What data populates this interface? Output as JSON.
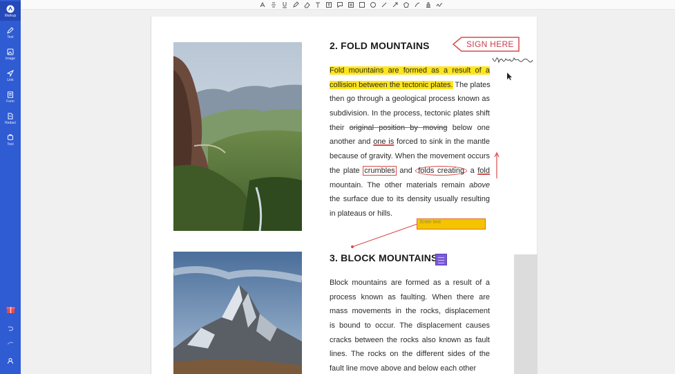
{
  "sidebar": {
    "items": [
      {
        "label": "Markup",
        "icon": "markup-icon"
      },
      {
        "label": "Text",
        "icon": "pencil-icon"
      },
      {
        "label": "Image",
        "icon": "image-icon"
      },
      {
        "label": "Link",
        "icon": "link-icon"
      },
      {
        "label": "Form",
        "icon": "form-icon"
      },
      {
        "label": "Redact",
        "icon": "redact-icon"
      },
      {
        "label": "Tool",
        "icon": "tool-icon"
      }
    ],
    "bottom_icons": [
      "gift-icon",
      "undo-icon",
      "redo-icon",
      "user-icon"
    ]
  },
  "toolbar": {
    "icons": [
      "highlight-icon",
      "strikethrough-icon",
      "underline-icon",
      "pencil-icon",
      "eraser-icon",
      "text-icon",
      "textbox-icon",
      "callout-icon",
      "note-icon",
      "rectangle-icon",
      "circle-icon",
      "line-icon",
      "arrow-icon",
      "polygon-icon",
      "pen-icon",
      "stamp-icon",
      "signature-icon"
    ]
  },
  "document": {
    "section1": {
      "heading": "2. FOLD MOUNTAINS",
      "lines": [
        {
          "parts": [
            {
              "t": "Fold mountains are formed as a result of a",
              "s": "hl"
            }
          ]
        },
        {
          "parts": [
            {
              "t": "collision between the tectonic plates.",
              "s": "hl"
            },
            {
              "t": " The plates"
            }
          ]
        },
        {
          "parts": [
            {
              "t": "then go through a geological process known as"
            }
          ]
        },
        {
          "parts": [
            {
              "t": "subdivision. In the process, tectonic plates shift"
            }
          ]
        },
        {
          "parts": [
            {
              "t": "their "
            },
            {
              "t": "original position by moving",
              "s": "strike"
            },
            {
              "t": " below one"
            }
          ]
        },
        {
          "parts": [
            {
              "t": "another and "
            },
            {
              "t": "one is",
              "s": "uline"
            },
            {
              "t": " forced to sink in the mantle"
            }
          ]
        },
        {
          "parts": [
            {
              "t": "because of gravity. When the movement occurs"
            }
          ]
        },
        {
          "parts": [
            {
              "t": "the plate "
            },
            {
              "t": "crumbles",
              "s": "boxed"
            },
            {
              "t": " and "
            },
            {
              "t": "folds creating",
              "s": "oval"
            },
            {
              "t": " a "
            },
            {
              "t": "fold",
              "s": "uline"
            }
          ]
        },
        {
          "parts": [
            {
              "t": "mountain. The other materials remain "
            },
            {
              "t": "above",
              "s": "italic"
            }
          ]
        },
        {
          "parts": [
            {
              "t": "the surface due to its density usually resulting"
            }
          ]
        },
        {
          "parts": [
            {
              "t": "in plateaus or hills."
            }
          ]
        }
      ]
    },
    "section2": {
      "heading": "3. BLOCK MOUNTAINS",
      "lines": [
        {
          "parts": [
            {
              "t": "Block mountains are formed as a result of a"
            }
          ]
        },
        {
          "parts": [
            {
              "t": "process known as faulting. When there are"
            }
          ]
        },
        {
          "parts": [
            {
              "t": "mass movements in the rocks, displacement"
            }
          ]
        },
        {
          "parts": [
            {
              "t": "is bound to occur. The displacement causes"
            }
          ]
        },
        {
          "parts": [
            {
              "t": "cracks between the rocks also known as fault"
            }
          ]
        },
        {
          "parts": [
            {
              "t": "lines. The rocks on the different sides of the"
            }
          ]
        },
        {
          "parts": [
            {
              "t": "fault line move above and below each other"
            }
          ]
        }
      ]
    }
  },
  "annotations": {
    "sign_here": "SIGN HERE",
    "callout_text": "Enter text",
    "colors": {
      "annotation_red": "#d94a4a",
      "highlight": "#ffe61a",
      "callout_fill": "#f5c400",
      "sticky_note": "#7a5ad6"
    }
  },
  "colors": {
    "sidebar": "#2f5bd3"
  }
}
